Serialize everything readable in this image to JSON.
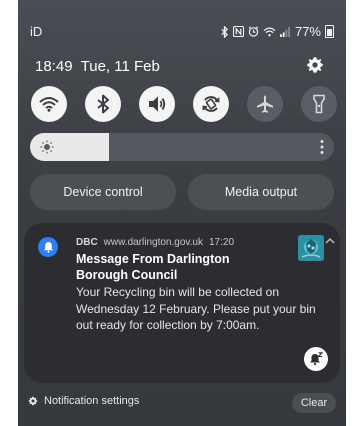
{
  "status_bar": {
    "carrier": "iD",
    "battery": "77%",
    "icons": [
      "bluetooth-icon",
      "nfc-icon",
      "alarm-icon",
      "wifi-icon",
      "signal-icon",
      "battery-icon"
    ]
  },
  "header": {
    "time": "18:49",
    "date": "Tue, 11 Feb"
  },
  "quick_toggles": [
    {
      "icon": "wifi-icon",
      "state": "on"
    },
    {
      "icon": "bluetooth-icon",
      "state": "on"
    },
    {
      "icon": "sound-icon",
      "state": "on"
    },
    {
      "icon": "auto-rotate-icon",
      "state": "on"
    },
    {
      "icon": "airplane-mode-icon",
      "state": "off"
    },
    {
      "icon": "flashlight-icon",
      "state": "off"
    }
  ],
  "brightness": {
    "level": 0.26
  },
  "buttons": {
    "device_control": "Device control",
    "media_output": "Media output"
  },
  "notification": {
    "app": "DBC",
    "source": "www.darlington.gov.uk",
    "time": "17:20",
    "title": "Message From Darlington Borough Council",
    "body": "Your Recycling bin will be collected on Wednesday 12 February. Please put your bin out ready for collection by 7:00am.",
    "accent": "#2f7cf4"
  },
  "footer": {
    "settings": "Notification settings",
    "clear": "Clear"
  }
}
